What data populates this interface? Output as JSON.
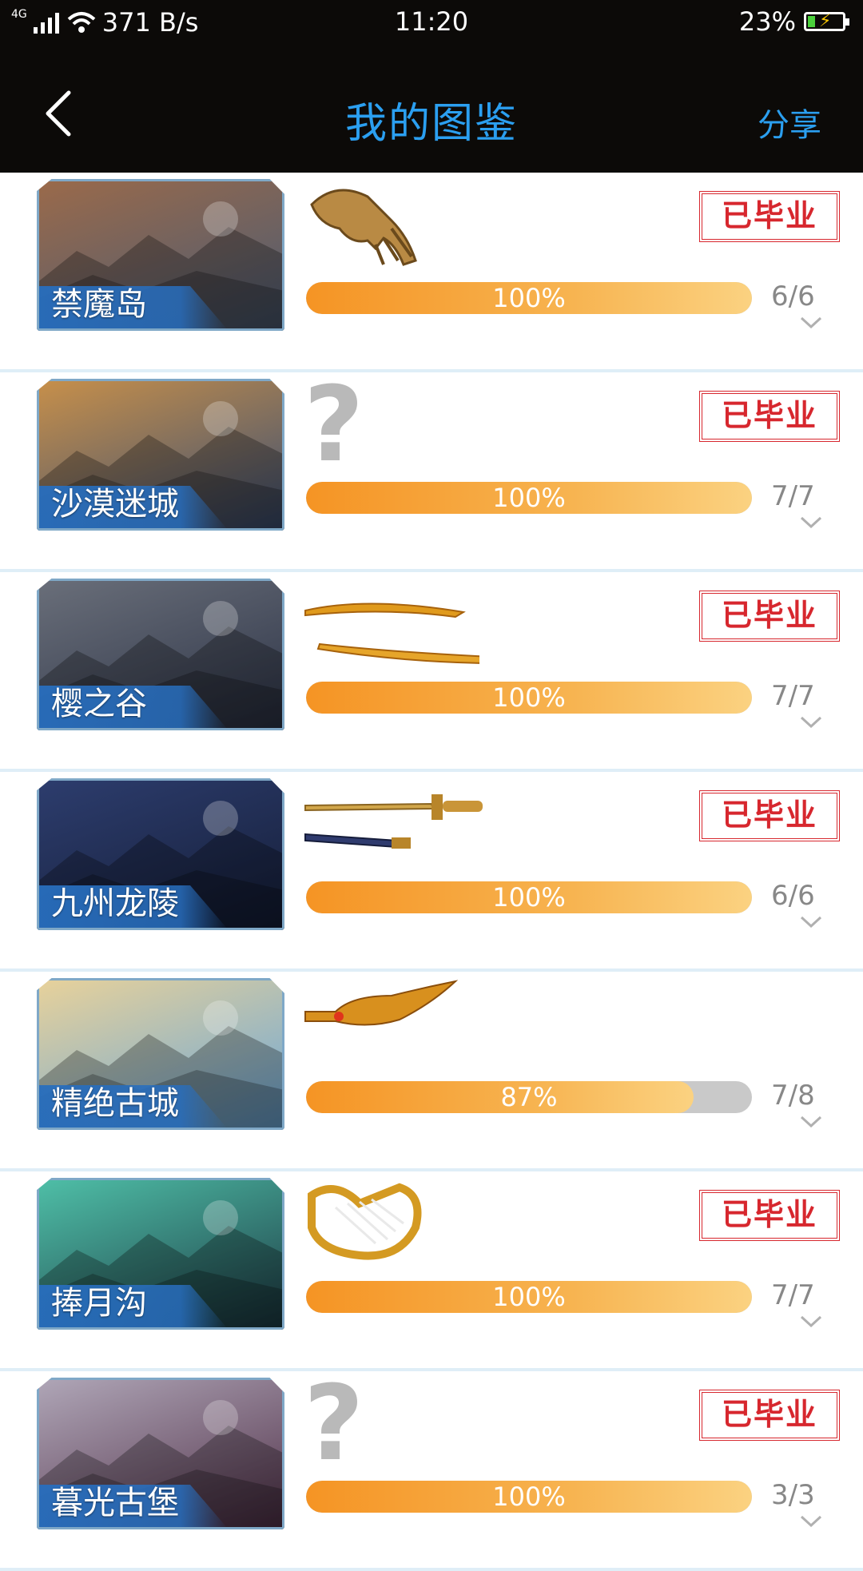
{
  "status_bar": {
    "network": "4G",
    "speed": "371 B/s",
    "time": "11:20",
    "battery": "23%",
    "battery_level": 0.23
  },
  "header": {
    "title": "我的图鉴",
    "share_label": "分享",
    "back_icon": "chevron-left-icon"
  },
  "stamp_text": "已毕业",
  "items": [
    {
      "name": "禁魔岛",
      "progress_label": "100%",
      "progress": 1.0,
      "count": "6/6",
      "item_icon": "gauntlet",
      "graduated": true,
      "scene_colors": [
        "#9b6a4a",
        "#4a5b73"
      ]
    },
    {
      "name": "沙漠迷城",
      "progress_label": "100%",
      "progress": 1.0,
      "count": "7/7",
      "item_icon": "unknown",
      "graduated": true,
      "scene_colors": [
        "#c8904a",
        "#3a4e72"
      ]
    },
    {
      "name": "樱之谷",
      "progress_label": "100%",
      "progress": 1.0,
      "count": "7/7",
      "item_icon": "dual-blades",
      "graduated": true,
      "scene_colors": [
        "#6a6f7a",
        "#2d3447"
      ]
    },
    {
      "name": "九州龙陵",
      "progress_label": "100%",
      "progress": 1.0,
      "count": "6/6",
      "item_icon": "sword",
      "graduated": true,
      "scene_colors": [
        "#2d3d6e",
        "#151e38"
      ]
    },
    {
      "name": "精绝古城",
      "progress_label": "87%",
      "progress": 0.87,
      "count": "7/8",
      "item_icon": "winged-blade",
      "graduated": false,
      "scene_colors": [
        "#e9d29a",
        "#6aa6d8"
      ]
    },
    {
      "name": "捧月沟",
      "progress_label": "100%",
      "progress": 1.0,
      "count": "7/7",
      "item_icon": "harp",
      "graduated": true,
      "scene_colors": [
        "#4fc0a8",
        "#1d3b45"
      ]
    },
    {
      "name": "暮光古堡",
      "progress_label": "100%",
      "progress": 1.0,
      "count": "3/3",
      "item_icon": "unknown",
      "graduated": true,
      "scene_colors": [
        "#b0a7b8",
        "#52324a"
      ]
    }
  ]
}
